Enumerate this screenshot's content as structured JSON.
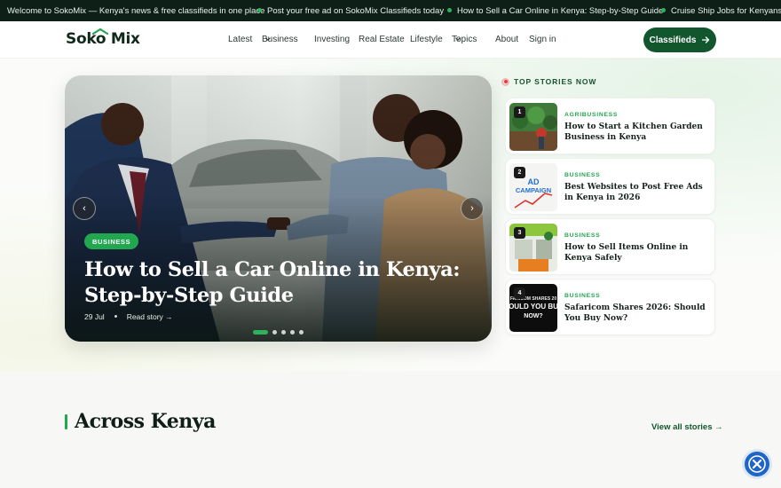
{
  "ticker": [
    "Welcome to SokoMix — Kenya's news & free classifieds in one place",
    "Post your free ad on SokoMix Classifieds today",
    "How to Sell a Car Online in Kenya: Step-by-Step Guide",
    "Cruise Ship Jobs for Kenyans: Sala"
  ],
  "header": {
    "logo": "Soko Mix",
    "nav": [
      "Latest",
      "Business",
      "Investing",
      "Real Estate",
      "Lifestyle",
      "Topics",
      "About",
      "Sign in"
    ],
    "cta_label": "Classifieds",
    "cta_icon": "arrow-right-icon"
  },
  "hero": {
    "badge": "BUSINESS",
    "title": "How to Sell a Car Online in Kenya: Step-by-Step Guide",
    "date": "29 Jul",
    "read_label": "Read story →",
    "slides_total": 5,
    "active_slide": 1
  },
  "top_stories": {
    "heading": "TOP STORIES NOW",
    "items": [
      {
        "num": "1",
        "category": "AGRIBUSINESS",
        "title": "How to Start a Kitchen Garden Business in Kenya"
      },
      {
        "num": "2",
        "category": "BUSINESS",
        "title": "Best Websites to Post Free Ads in Kenya in 2026"
      },
      {
        "num": "3",
        "category": "BUSINESS",
        "title": "How to Sell Items Online in Kenya Safely"
      },
      {
        "num": "4",
        "category": "BUSINESS",
        "title": "Safaricom Shares 2026: Should You Buy Now?"
      }
    ],
    "thumb_texts": {
      "ad_line1": "AD",
      "ad_line2": "CAMPAIGN",
      "saf_line1": "FARICOM SHARES 20",
      "saf_line2": "OULD YOU BU",
      "saf_line3": "NOW?"
    }
  },
  "section": {
    "title": "Across Kenya",
    "view_all": "View all stories →"
  },
  "colors": {
    "brand": "#12562d",
    "accent": "#22a64f",
    "ticker_bg": "#0d1f17"
  }
}
